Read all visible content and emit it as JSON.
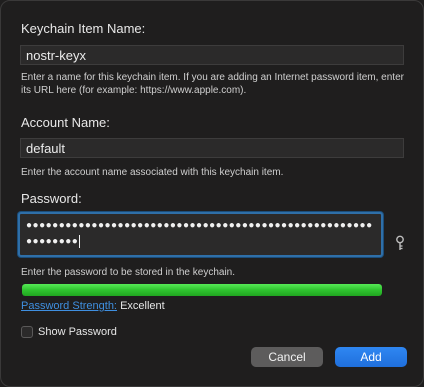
{
  "dialog": {
    "item_name_label": "Keychain Item Name:",
    "item_name_value": "nostr-keyx",
    "item_name_help": "Enter a name for this keychain item. If you are adding an Internet password item, enter its URL here (for example: https://www.apple.com).",
    "account_name_label": "Account Name:",
    "account_name_value": "default",
    "account_name_help": "Enter the account name associated with this keychain item.",
    "password_label": "Password:",
    "password_value": "●●●●●●●●●●●●●●●●●●●●●●●●●●●●●●●●●●●●●●●●●●●●●●●●●●●●●●●●●●●●●",
    "password_help": "Enter the password to be stored in the keychain.",
    "strength_link": "Password Strength:",
    "strength_value": "Excellent",
    "strength_level": 1.0,
    "show_password_label": "Show Password",
    "show_password_checked": false,
    "cancel_label": "Cancel",
    "add_label": "Add"
  },
  "icons": {
    "password_assistant": "key-icon"
  },
  "colors": {
    "accent": "#2f80ed",
    "strength": "#3fd43f",
    "link": "#3f8fe0"
  }
}
